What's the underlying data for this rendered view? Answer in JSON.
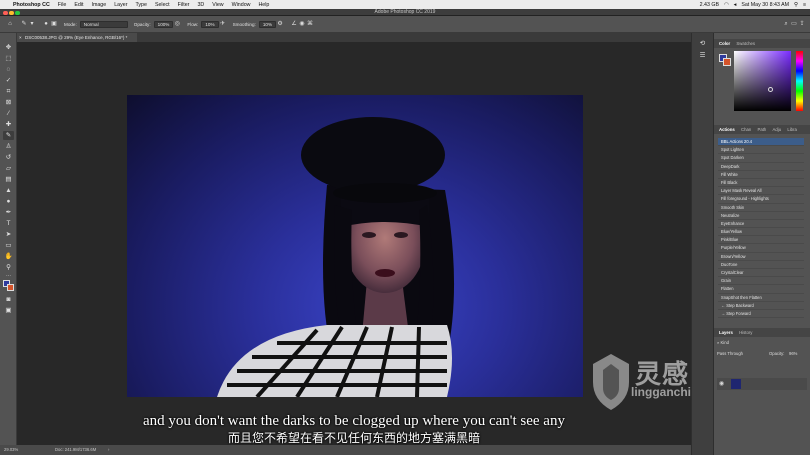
{
  "menubar": {
    "apple_glyph": "",
    "app_name": "Photoshop CC",
    "items": [
      "File",
      "Edit",
      "Image",
      "Layer",
      "Type",
      "Select",
      "Filter",
      "3D",
      "View",
      "Window",
      "Help"
    ],
    "storage": "2.43 GB",
    "datetime": "Sat May 30  8:43 AM"
  },
  "titlebar": {
    "title": "Adobe Photoshop CC 2019"
  },
  "options": {
    "mode_label": "Mode:",
    "mode_value": "Normal",
    "opacity_label": "Opacity:",
    "opacity_value": "100%",
    "flow_label": "Flow:",
    "flow_value": "10%",
    "smoothing_label": "Smoothing:",
    "smoothing_value": "10%"
  },
  "document_tab": {
    "label": "DSC00538.JPG @ 29% (Eye Enhance, RGB/16*) *"
  },
  "subtitles": {
    "english": "and you don't want the darks to be clogged up where you can't see any",
    "chinese": "而且您不希望在看不见任何东西的地方塞满黑暗"
  },
  "statusbar": {
    "zoom": "29.03%",
    "doc": "Doc: 241.9M/1736.6M"
  },
  "watermark": {
    "cn": "灵感中国",
    "url": "lingganchina.com"
  },
  "color_panel": {
    "tabs": [
      "Color",
      "Swatches"
    ]
  },
  "actions_panel": {
    "tabs": [
      "Actions",
      "Chan",
      "Path",
      "Adju",
      "Libra"
    ],
    "items": [
      "BBL Actions 20.4",
      "Spot Lighten",
      "Spot Darken",
      "DeepDark",
      "Fill White",
      "Fill Black",
      "Layer Mask Reveal All",
      "Fill foreground - Highlights",
      "Smooth Skin",
      "Neutralize",
      "EyeEnhance",
      "Blue/Yellow",
      "Pink/Blue",
      "Purple/Yellow",
      "Brown/Yellow",
      "DuoTone",
      "CrystalClear",
      "Grain",
      "Flatten",
      "SnapShot then Flatten",
      "← Step Backward",
      "→ Step Forward"
    ],
    "selected_index": 0
  },
  "layers_panel": {
    "tabs": [
      "Layers",
      "History"
    ],
    "filter": "Kind",
    "blend": "Pass Through",
    "opacity_label": "Opacity:",
    "opacity_value": "96%"
  },
  "colors": {
    "foreground": "#2f3a9d",
    "background": "#d4542b"
  }
}
